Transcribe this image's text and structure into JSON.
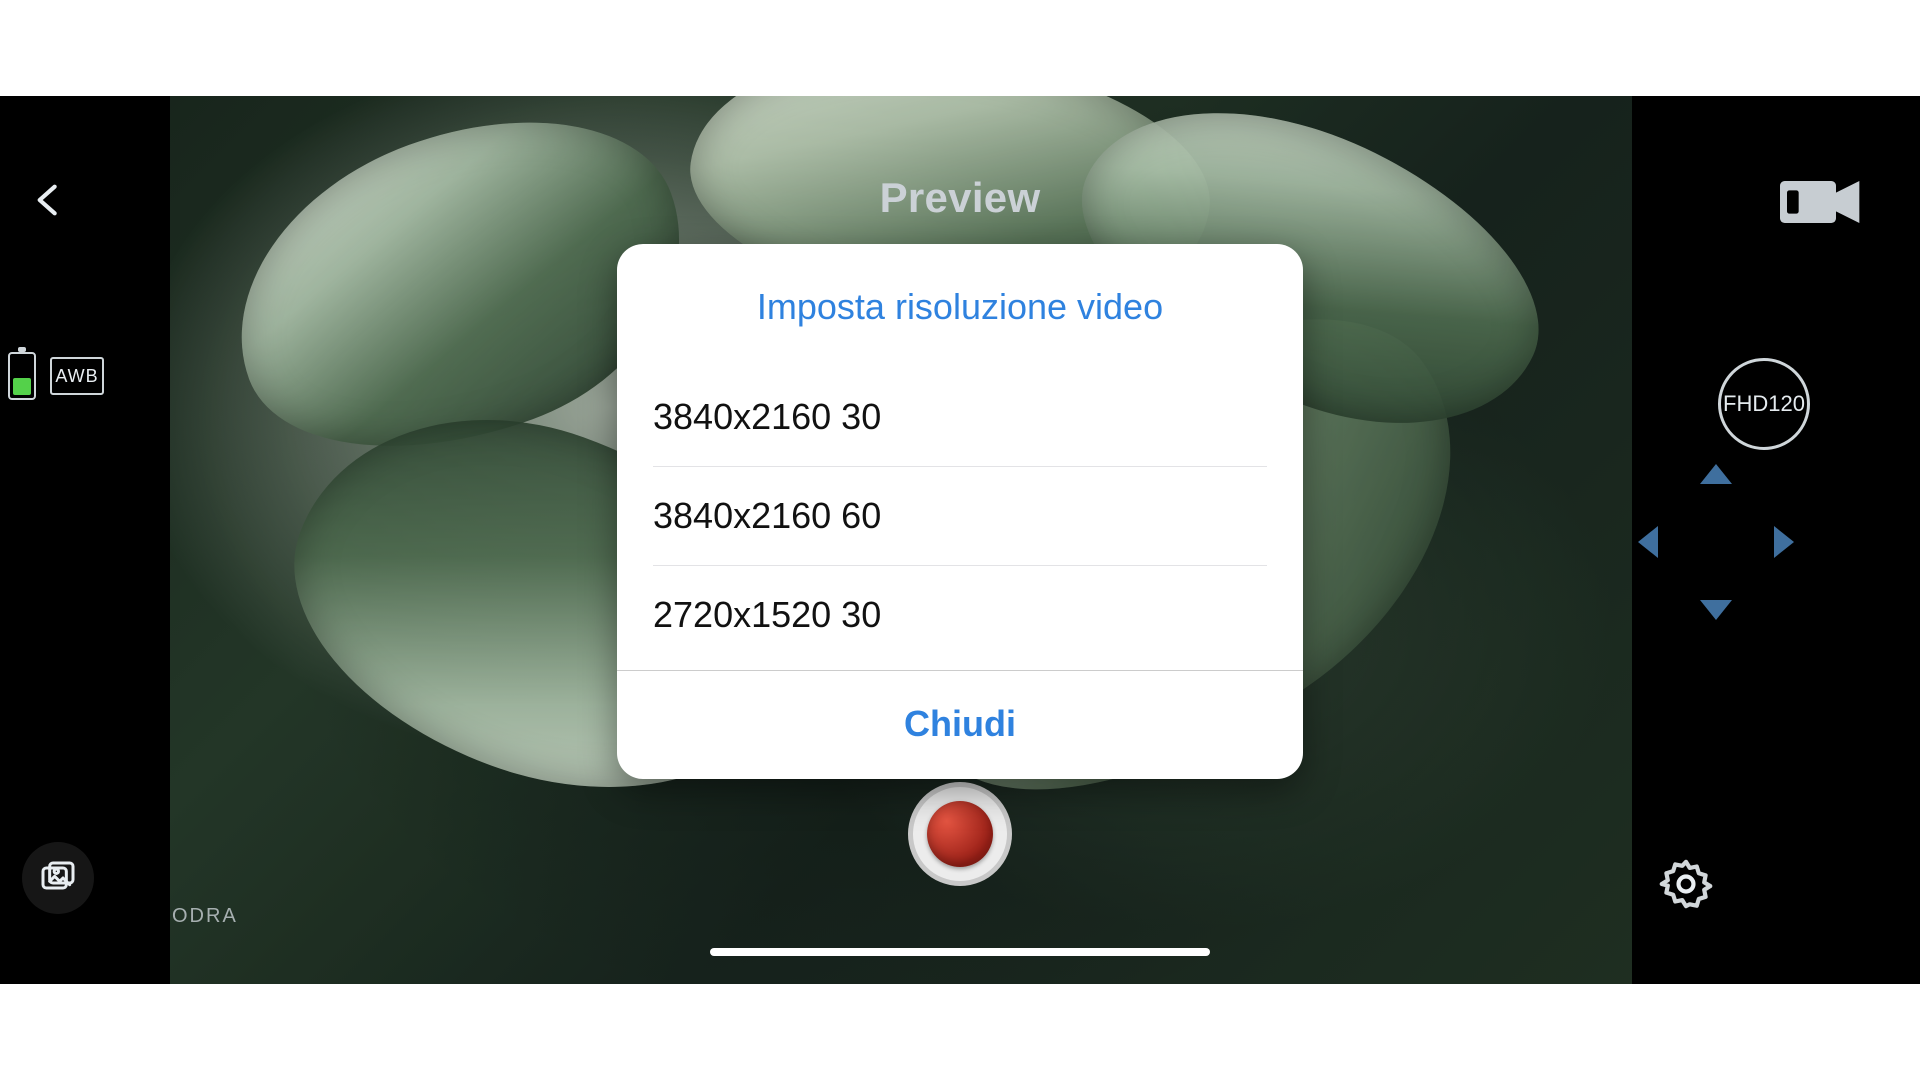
{
  "header": {
    "title": "Preview"
  },
  "left": {
    "awb_label": "AWB"
  },
  "watermark": "ODRA",
  "right": {
    "mode_label": "FHD120"
  },
  "dialog": {
    "title": "Imposta risoluzione video",
    "options": [
      "3840x2160 30",
      "3840x2160 60",
      "2720x1520 30"
    ],
    "close_label": "Chiudi"
  }
}
